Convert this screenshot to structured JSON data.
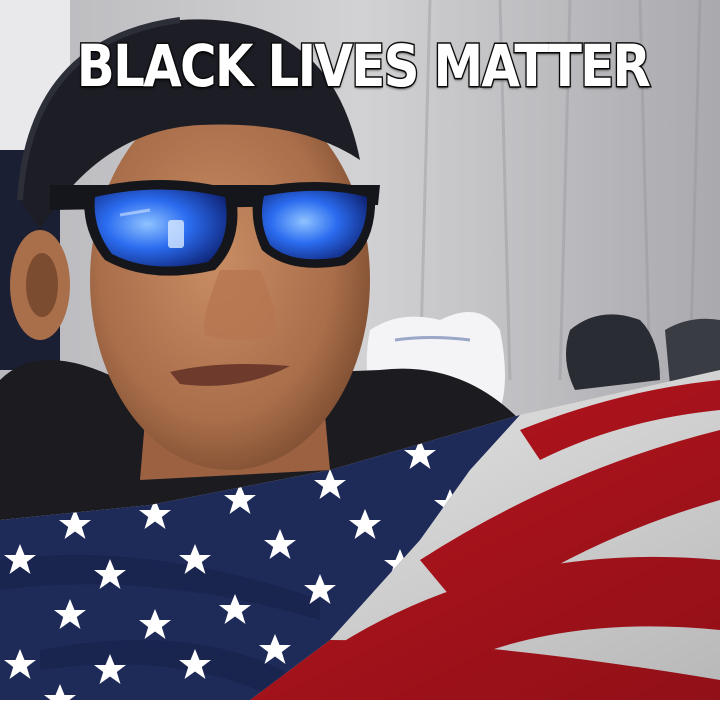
{
  "caption": {
    "text": "BLACK LIVES MATTER",
    "color": "#ffffff",
    "outline_color": "#111111"
  },
  "scene": {
    "subject": "person",
    "accessories": [
      "cap",
      "sunglasses"
    ],
    "flag": "united-states-flag",
    "colors": {
      "flag_red": "#c0151f",
      "flag_white": "#f2f2f2",
      "flag_blue": "#1e2a58",
      "lens_blue": "#2b6cf0",
      "cap": "#1c1d25",
      "background_curtain": "#c9c9cb"
    }
  }
}
